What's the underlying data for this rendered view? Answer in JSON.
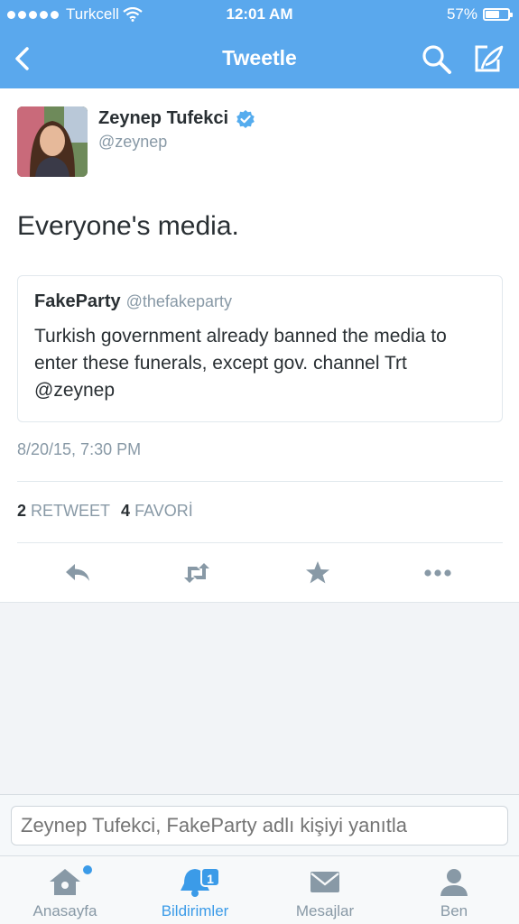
{
  "status_bar": {
    "carrier": "Turkcell",
    "time": "12:01 AM",
    "battery_percent": "57%",
    "battery_level": 0.57
  },
  "nav": {
    "title": "Tweetle",
    "back_icon": "chevron-left-icon",
    "search_icon": "search-icon",
    "compose_icon": "compose-icon"
  },
  "tweet": {
    "author_name": "Zeynep Tufekci",
    "author_handle": "@zeynep",
    "verified_icon": "verified-badge-icon",
    "text": "Everyone's media.",
    "quoted": {
      "name": "FakeParty",
      "handle": "@thefakeparty",
      "text": "Turkish government already banned the media to enter these funerals, except gov. channel  Trt @zeynep"
    },
    "timestamp": "8/20/15, 7:30 PM",
    "retweet_count": "2",
    "retweet_label": "RETWEET",
    "favorite_count": "4",
    "favorite_label": "FAVORİ"
  },
  "actions": [
    "reply-icon",
    "retweet-icon",
    "star-icon",
    "more-icon"
  ],
  "reply": {
    "placeholder": "Zeynep Tufekci, FakeParty adlı kişiyi yanıtla"
  },
  "tabs": [
    {
      "label": "Anasayfa",
      "icon": "home-icon"
    },
    {
      "label": "Bildirimler",
      "icon": "bell-icon",
      "badge": "1"
    },
    {
      "label": "Mesajlar",
      "icon": "envelope-icon"
    },
    {
      "label": "Ben",
      "icon": "person-icon"
    }
  ],
  "colors": {
    "brand": "#5aa8ed",
    "accent": "#3b9be8",
    "muted": "#8899a6",
    "text": "#292f33"
  }
}
